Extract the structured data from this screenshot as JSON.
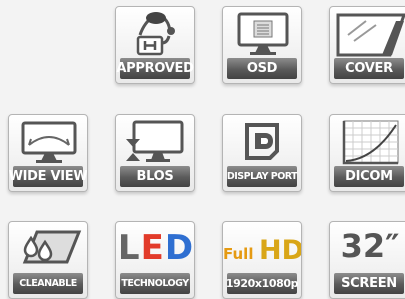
{
  "features": [
    {
      "id": "approved",
      "label": "APPROVED",
      "icon": "doctor-approved-icon"
    },
    {
      "id": "osd",
      "label": "OSD",
      "icon": "on-screen-display-icon"
    },
    {
      "id": "cover",
      "label": "COVER",
      "icon": "cover-icon"
    },
    {
      "id": "wide-view",
      "label": "WIDE VIEW",
      "icon": "wide-view-icon"
    },
    {
      "id": "blos",
      "label": "BLOS",
      "icon": "blos-icon"
    },
    {
      "id": "display-port",
      "label": "DISPLAY PORT",
      "icon": "displayport-icon"
    },
    {
      "id": "dicom",
      "label": "DICOM",
      "icon": "dicom-curve-icon"
    },
    {
      "id": "cleanable",
      "label": "CLEANABLE",
      "icon": "cleanable-drops-icon"
    },
    {
      "id": "led",
      "label": "TECHNOLOGY",
      "icon": "led-icon",
      "title_letters": [
        "L",
        "E",
        "D"
      ],
      "title_colors": [
        "#e23b2a",
        "#2f9a3a",
        "#2f6fd1"
      ]
    },
    {
      "id": "fullhd",
      "label": "1920x1080p",
      "icon": "full-hd-icon",
      "title_small": "Full",
      "title_large": "HD"
    },
    {
      "id": "screen",
      "label": "SCREEN",
      "icon": "screen-size-icon",
      "title": "32″"
    }
  ]
}
